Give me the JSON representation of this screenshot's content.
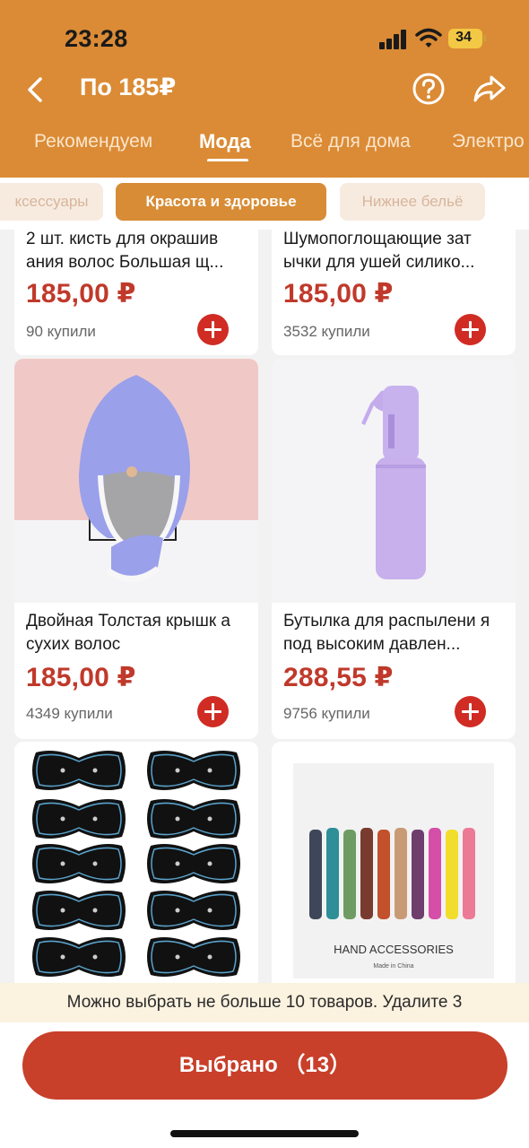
{
  "status_bar": {
    "time": "23:28",
    "battery": "34"
  },
  "header": {
    "title": "По 185₽"
  },
  "tabs": [
    {
      "label": "Рекомендуем"
    },
    {
      "label": "Мода"
    },
    {
      "label": "Всё для дома"
    },
    {
      "label": "Электро"
    }
  ],
  "chips": [
    {
      "label": "ксессуары"
    },
    {
      "label": "Красота и здоровье"
    },
    {
      "label": "Нижнее бельё"
    }
  ],
  "products": [
    {
      "title": "2 шт. кисть для окрашив ания волос Большая щ...",
      "price": "185,00 ₽",
      "sold": "90 купили"
    },
    {
      "title": "Шумопоглощающие зат ычки для ушей силико...",
      "price": "185,00 ₽",
      "sold": "3532 купили"
    },
    {
      "title": "Двойная Толстая крышк а сухих волос",
      "price": "185,00 ₽",
      "sold": "4349 купили"
    },
    {
      "title": "Бутылка для распылени я под высоким давлен...",
      "price": "288,55 ₽",
      "sold": "9756 купили"
    },
    {
      "image_text": ""
    },
    {
      "image_text": "HAND ACCESSORIES",
      "image_subtext": "Made in China"
    }
  ],
  "notice": "Можно выбрать не больше 10 товаров. Удалите 3",
  "bottom": {
    "selected_button": "Выбрано （13）"
  },
  "colors": {
    "header": "#db8b35",
    "price": "#c0392b",
    "add_button": "#d02c24",
    "cta": "#c83f2a",
    "notice_bg": "#fbf2df"
  }
}
